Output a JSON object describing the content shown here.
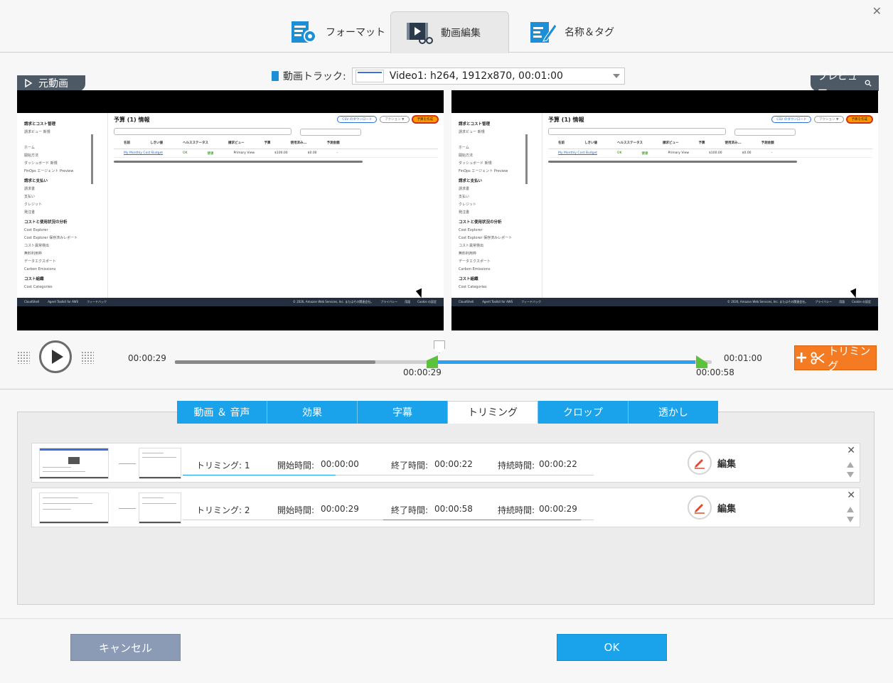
{
  "top_tabs": [
    {
      "label": "フォーマット",
      "icon": "format-settings-icon"
    },
    {
      "label": "動画編集",
      "icon": "video-edit-icon"
    },
    {
      "label": "名称＆タグ",
      "icon": "name-tag-icon"
    }
  ],
  "track": {
    "label": "動画トラック:",
    "value": "Video1: h264, 1912x870, 00:01:00"
  },
  "source_label": "元動画",
  "preview_label": "プレビュー",
  "screen": {
    "sidebar_title": "請求とコスト管理",
    "sidebar_items": [
      {
        "t": "請求ビュー 新規",
        "h": false
      },
      {
        "t": "",
        "h": false
      },
      {
        "t": "ホーム",
        "h": false
      },
      {
        "t": "開始方法",
        "h": false
      },
      {
        "t": "ダッシュボード 新規",
        "h": false
      },
      {
        "t": "FinOps エージェント Preview",
        "h": false
      },
      {
        "t": "請求と支払い",
        "h": true
      },
      {
        "t": "請求書",
        "h": false
      },
      {
        "t": "支払い",
        "h": false
      },
      {
        "t": "クレジット",
        "h": false
      },
      {
        "t": "発注書",
        "h": false
      },
      {
        "t": "コストと使用状況の分析",
        "h": true
      },
      {
        "t": "Cost Explorer",
        "h": false
      },
      {
        "t": "Cost Explorer 保存済みレポート",
        "h": false
      },
      {
        "t": "コスト異常検出",
        "h": false
      },
      {
        "t": "無料利用枠",
        "h": false
      },
      {
        "t": "データエクスポート",
        "h": false
      },
      {
        "t": "Carbon Emissions",
        "h": false
      },
      {
        "t": "コスト組織",
        "h": true
      },
      {
        "t": "Cost Categories",
        "h": false
      }
    ],
    "title": "予算 (1) 情報",
    "btn_csv": "CSV のダウンロード",
    "btn_action": "アクション ▼",
    "btn_create": "予算を作成",
    "search_placeholder": "予算を検索",
    "filter": "タイプ：すべての予算を表示 ▼",
    "columns": [
      "名前",
      "しきい値",
      "ヘルスステータス",
      "請求ビュー",
      "予算",
      "使用済み...",
      "予測金額"
    ],
    "row": [
      "My Monthly Cost Budget",
      "OK",
      "健康",
      "Primary View",
      "$100.00",
      "$0.00",
      "-"
    ],
    "footer_left": [
      "CloudShell",
      "Agent Toolkit for AWS",
      "フィードバック"
    ],
    "footer_right": [
      "© 2026, Amazon Web Services, Inc. またはその関連会社。",
      "プライバシー",
      "用語",
      "Cookie の設定"
    ]
  },
  "controls": {
    "current_time": "00:00:29",
    "end_time": "00:01:00",
    "start_marker": "00:00:29",
    "end_marker": "00:00:58",
    "played_fraction": 0.373,
    "trim_button": "トリミング"
  },
  "sub_tabs": [
    "動画 ＆ 音声",
    "効果",
    "字幕",
    "トリミング",
    "クロップ",
    "透かし"
  ],
  "clips": [
    {
      "name": "トリミング: 1",
      "start_label": "開始時間:",
      "start": "00:00:00",
      "end_label": "終了時間:",
      "end": "00:00:22",
      "dur_label": "持続時間:",
      "dur": "00:00:22",
      "edit": "編集"
    },
    {
      "name": "トリミング: 2",
      "start_label": "開始時間:",
      "start": "00:00:29",
      "end_label": "終了時間:",
      "end": "00:00:58",
      "dur_label": "持続時間:",
      "dur": "00:00:29",
      "edit": "編集"
    }
  ],
  "footer": {
    "cancel": "キャンセル",
    "ok": "OK"
  },
  "colors": {
    "accent_blue": "#1aa3ea",
    "trim_orange": "#f57b23",
    "handle_green": "#5cc13b",
    "cancel_gray": "#8b9bb6"
  }
}
